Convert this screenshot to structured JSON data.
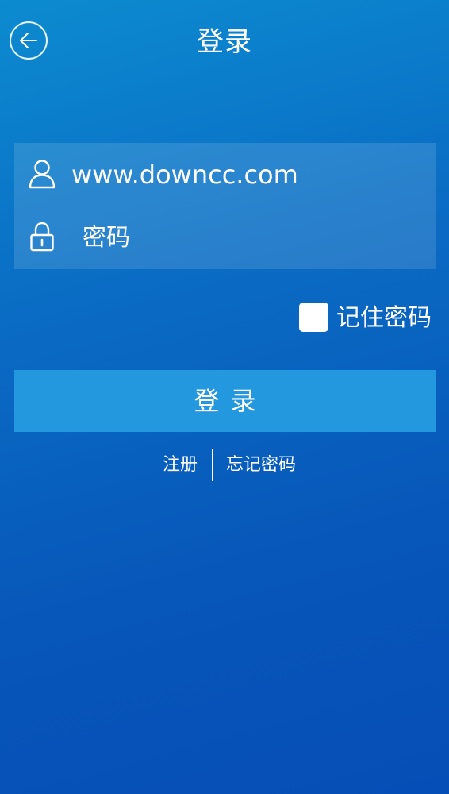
{
  "header": {
    "title": "登录",
    "back_icon": "arrow-left-icon"
  },
  "form": {
    "username": {
      "icon": "user-icon",
      "value": "www.downcc.com"
    },
    "password": {
      "icon": "lock-icon",
      "placeholder": "密码"
    }
  },
  "remember": {
    "label": "记住密码",
    "checked": false
  },
  "login_button": {
    "label": "登录"
  },
  "links": {
    "register": "注册",
    "forgot_password": "忘记密码"
  },
  "colors": {
    "background_top": "#0c8bd0",
    "background_bottom": "#064eb7",
    "button": "#2398de",
    "text": "#ffffff"
  }
}
